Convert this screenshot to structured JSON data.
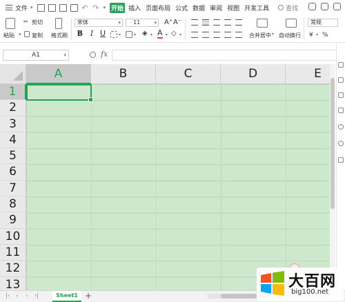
{
  "menu": {
    "file_label": "文件",
    "tabs": [
      "开始",
      "插入",
      "页面布局",
      "公式",
      "数据",
      "审阅",
      "视图",
      "开发工具"
    ],
    "active_tab": "开始",
    "search_label": "查找"
  },
  "ribbon": {
    "paste": "粘贴",
    "cut": "剪切",
    "copy": "复制",
    "format_painter": "格式刷",
    "font_name": "宋体",
    "font_size": "11",
    "grow_font": "A⁺",
    "shrink_font": "A⁻",
    "bold": "B",
    "italic": "I",
    "underline": "U",
    "merge_center": "合并居中",
    "wrap_text": "自动换行",
    "number_format": "常规",
    "currency": "¥",
    "percent": "%"
  },
  "formula_bar": {
    "name_box": "A1",
    "fx_label": "fx",
    "formula_value": ""
  },
  "sheet": {
    "columns": [
      "A",
      "B",
      "C",
      "D",
      "E"
    ],
    "rows": [
      "1",
      "2",
      "3",
      "4",
      "5",
      "6",
      "7",
      "8",
      "9",
      "10",
      "11",
      "12",
      "13"
    ],
    "active_column": "A",
    "active_row": "1",
    "grid_color": "#cde8cc",
    "accent_color": "#23a455"
  },
  "tabs": {
    "sheets": [
      "Sheet1"
    ],
    "active_sheet": "Sheet1",
    "add_label": "+"
  },
  "watermark": {
    "big_text": "大百网",
    "small_text": "big100.net"
  }
}
